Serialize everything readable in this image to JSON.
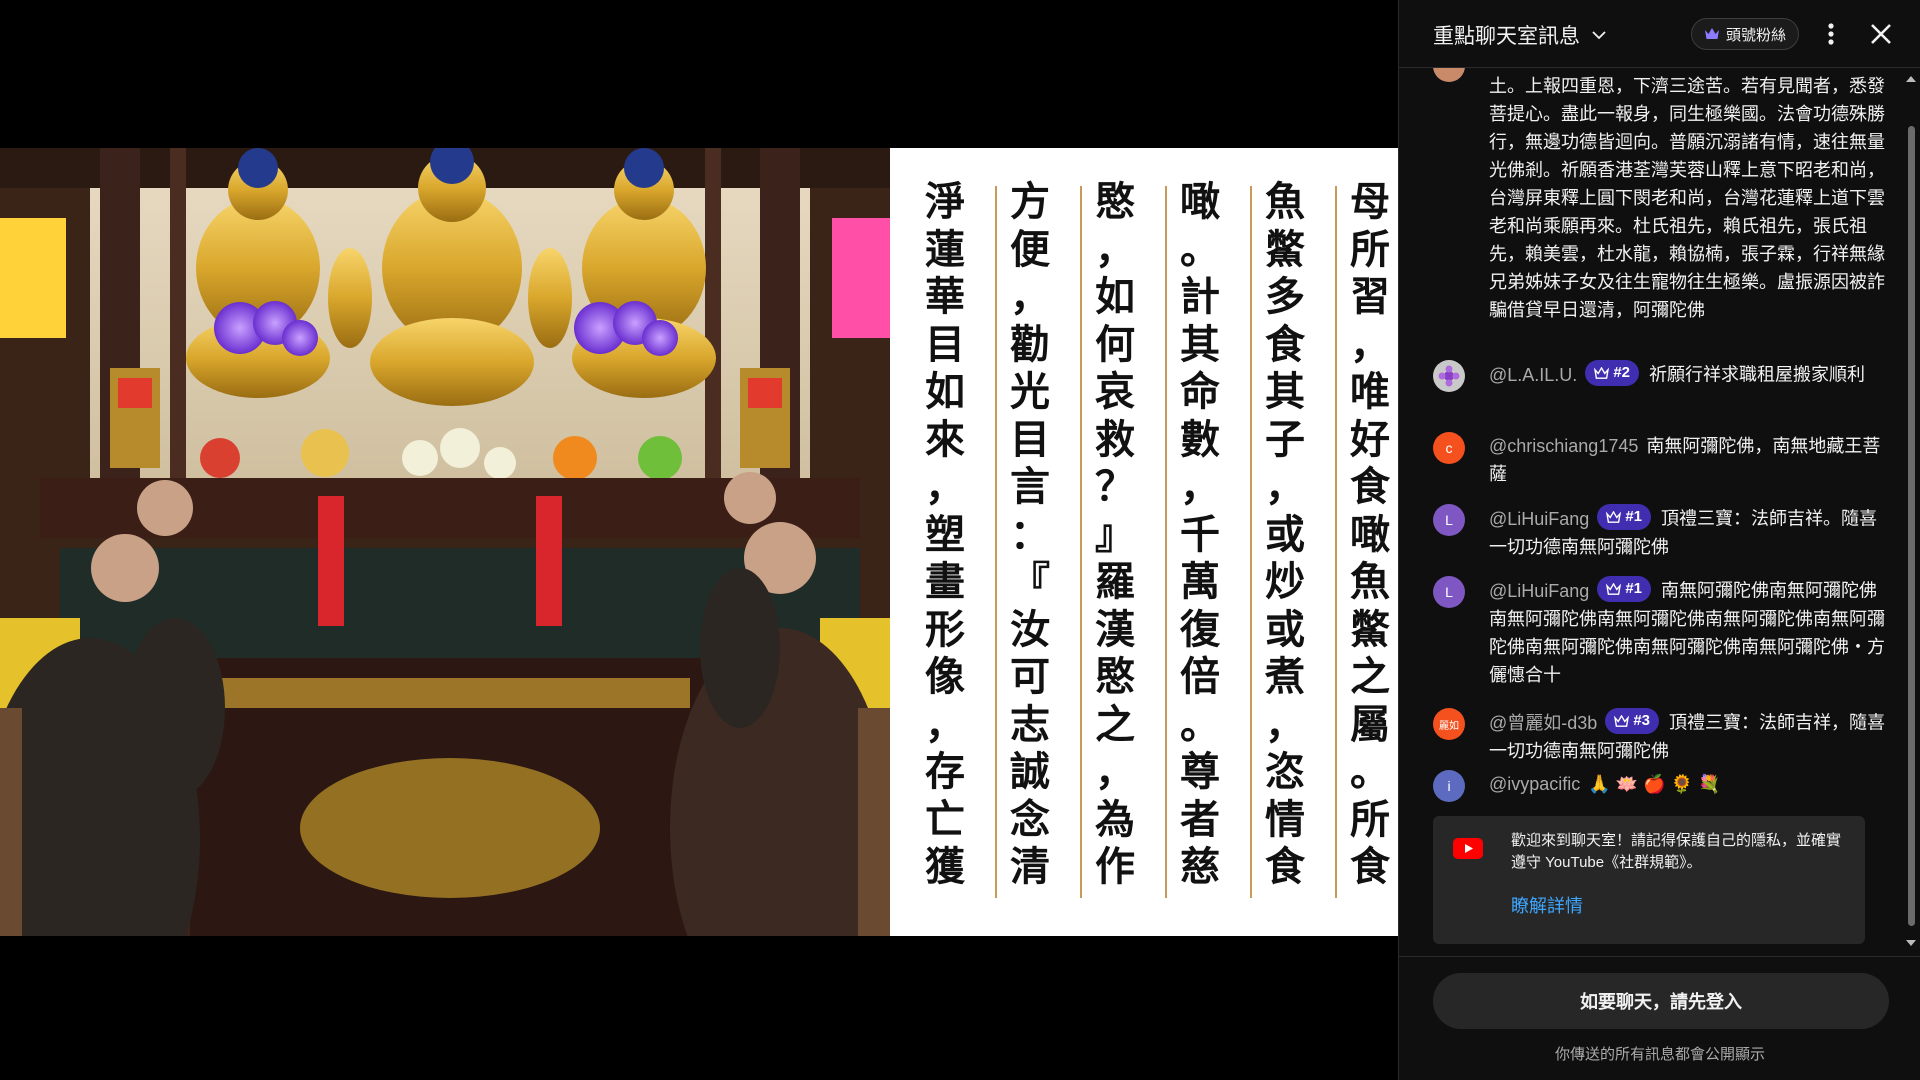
{
  "scripture": {
    "columns": [
      "母所習，唯好食噉魚鱉之屬。所食",
      "魚鱉多食其子，或炒或煮，恣情食",
      "噉。計其命數，千萬復倍。尊者慈",
      "愍，如何哀救？』羅漢愍之，為作",
      "方便，勸光目言：『汝可志誠念清",
      "淨蓮華目如來，塑畫形像，存亡獲"
    ]
  },
  "header": {
    "title": "重點聊天室訊息",
    "fan_badge": "頭號粉絲"
  },
  "messages": [
    {
      "text": "土。上報四重恩，下濟三途苦。若有見聞者，悉發菩提心。盡此一報身，同生極樂國。法會功德殊勝行，無邊功德皆迴向。普願沉溺諸有情，速往無量光佛剎。祈願香港荃灣芙蓉山釋上意下昭老和尚，台灣屏東釋上圓下閔老和尚，台灣花蓮釋上道下雲老和尚乘願再來。杜氏祖先，賴氏祖先，張氏祖先，賴美雲，杜水龍，賴協楠，張子霖，行祥無緣兄弟姊妹子女及往生寵物往生極樂。盧振源因被詐騙借貸早日還清，阿彌陀佛"
    },
    {
      "author": "@L.A.IL.U.",
      "rank": "#2",
      "text": "祈願行祥求職租屋搬家順利",
      "avatar_color": "#c9c9c9"
    },
    {
      "author": "@chrischiang1745",
      "avatar_letter": "c",
      "avatar_color": "#f4511e",
      "text": "南無阿彌陀佛，南無地藏王菩薩"
    },
    {
      "author": "@LiHuiFang",
      "rank": "#1",
      "avatar_letter": "L",
      "avatar_color": "#7e57c2",
      "text": "頂禮三寶：法師吉祥。隨喜一切功德南無阿彌陀佛"
    },
    {
      "author": "@LiHuiFang",
      "rank": "#1",
      "avatar_letter": "L",
      "avatar_color": "#7e57c2",
      "text": "南無阿彌陀佛南無阿彌陀佛南無阿彌陀佛南無阿彌陀佛南無阿彌陀佛南無阿彌陀佛南無阿彌陀佛南無阿彌陀佛南無阿彌陀佛・方儷憓合十"
    },
    {
      "author": "@曾麗如-d3b",
      "rank": "#3",
      "avatar_letter": "麗如",
      "avatar_color": "#f4511e",
      "text": "頂禮三寶：法師吉祥，隨喜一切功德南無阿彌陀佛"
    },
    {
      "author": "@ivypacific",
      "avatar_letter": "i",
      "avatar_color": "#5c6bc0",
      "text": "🙏 🪷 🍎 🌻 💐"
    }
  ],
  "welcome": {
    "text": "歡迎來到聊天室！請記得保護自己的隱私，並確實遵守 YouTube《社群規範》。",
    "link": "瞭解詳情"
  },
  "footer": {
    "login_button": "如要聊天，請先登入",
    "note": "你傳送的所有訊息都會公開顯示"
  },
  "colors": {
    "chat_bg": "#0f0f0f",
    "rank_badge": "#3f2fb0",
    "link": "#3ea6ff",
    "youtube_red": "#ff0000"
  }
}
